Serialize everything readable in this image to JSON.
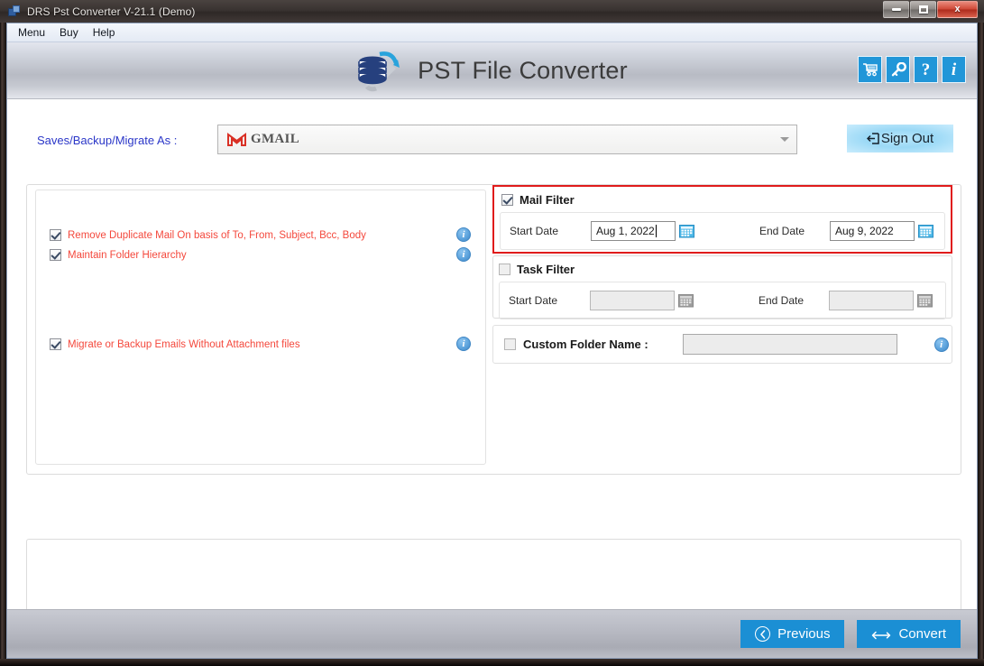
{
  "window": {
    "title": "DRS Pst Converter V-21.1 (Demo)",
    "icon": "app-icon",
    "controls": {
      "minimize": "–",
      "maximize": "□",
      "close": "x"
    }
  },
  "menubar": {
    "items": [
      {
        "label": "Menu"
      },
      {
        "label": "Buy"
      },
      {
        "label": "Help"
      }
    ]
  },
  "header": {
    "brand_title": "PST File Converter",
    "logo_icon": "database-logo-icon",
    "icons": [
      {
        "name": "cart-icon",
        "glyph": "🛒"
      },
      {
        "name": "key-icon",
        "glyph": "🔑"
      },
      {
        "name": "help-icon",
        "glyph": "?"
      },
      {
        "name": "info-icon",
        "glyph": "i"
      }
    ],
    "accent_color": "#2196d8"
  },
  "save_row": {
    "label": "Saves/Backup/Migrate As :",
    "label_color": "#2b37c8",
    "selected_value": "GMAIL",
    "provider_icon": "gmail-icon",
    "dropdown_icon": "chevron-down-icon",
    "sign_out_label": "Sign Out",
    "sign_out_icon": "exit-icon"
  },
  "options_panel": {
    "items": [
      {
        "label": "Remove Duplicate Mail On basis of To, From, Subject, Bcc, Body",
        "checked": true,
        "has_info": true
      },
      {
        "label": "Maintain Folder Hierarchy",
        "checked": true,
        "has_info": true
      },
      {
        "label": "Migrate or Backup Emails Without Attachment files",
        "checked": true,
        "has_info": true
      }
    ],
    "label_color": "#f4483c",
    "info_glyph": "i"
  },
  "mail_filter": {
    "title": "Mail Filter",
    "checked": true,
    "highlight_color": "#e01b1b",
    "start_label": "Start Date",
    "start_value": "Aug 1, 2022",
    "end_label": "End Date",
    "end_value": "Aug 9, 2022",
    "calendar_icon": "calendar-icon",
    "enabled": true
  },
  "task_filter": {
    "title": "Task Filter",
    "checked": false,
    "start_label": "Start Date",
    "start_value": "",
    "end_label": "End Date",
    "end_value": "",
    "calendar_icon": "calendar-icon",
    "enabled": false
  },
  "custom_folder": {
    "label": "Custom Folder Name :",
    "checked": false,
    "value": "",
    "has_info": true,
    "info_glyph": "i"
  },
  "log_panel": {
    "content": ""
  },
  "footer": {
    "previous_label": "Previous",
    "previous_icon": "chevron-left-circle-icon",
    "convert_label": "Convert",
    "convert_icon": "convert-arrows-icon",
    "button_color": "#1b8fd4"
  }
}
